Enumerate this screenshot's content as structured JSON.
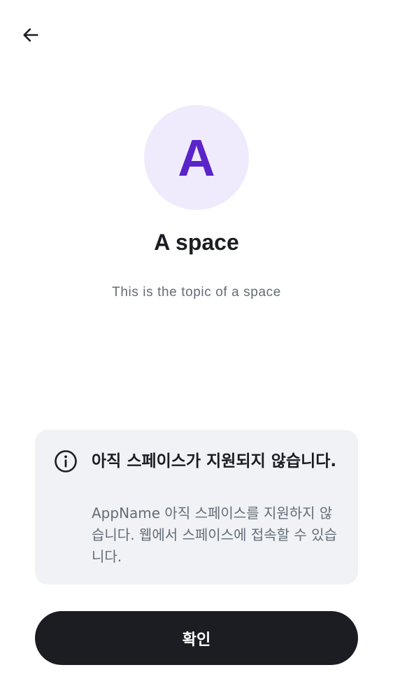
{
  "header": {
    "back_icon": "arrow-left-icon"
  },
  "space": {
    "avatar_letter": "A",
    "name": "A space",
    "topic": "This is the topic of a space"
  },
  "notice": {
    "icon": "info-icon",
    "title": "아직 스페이스가 지원되지 않습니다.",
    "body": "AppName 아직 스페이스를 지원하지 않습니다. 웹에서 스페이스에 접속할 수 있습니다."
  },
  "actions": {
    "confirm_label": "확인"
  },
  "colors": {
    "accent": "#5a24c9",
    "avatar_background": "#efebfd",
    "primary_text": "#1b1d22",
    "secondary_text": "#656d77",
    "card_background": "#f0f2f5",
    "button_background": "#1b1d22"
  }
}
